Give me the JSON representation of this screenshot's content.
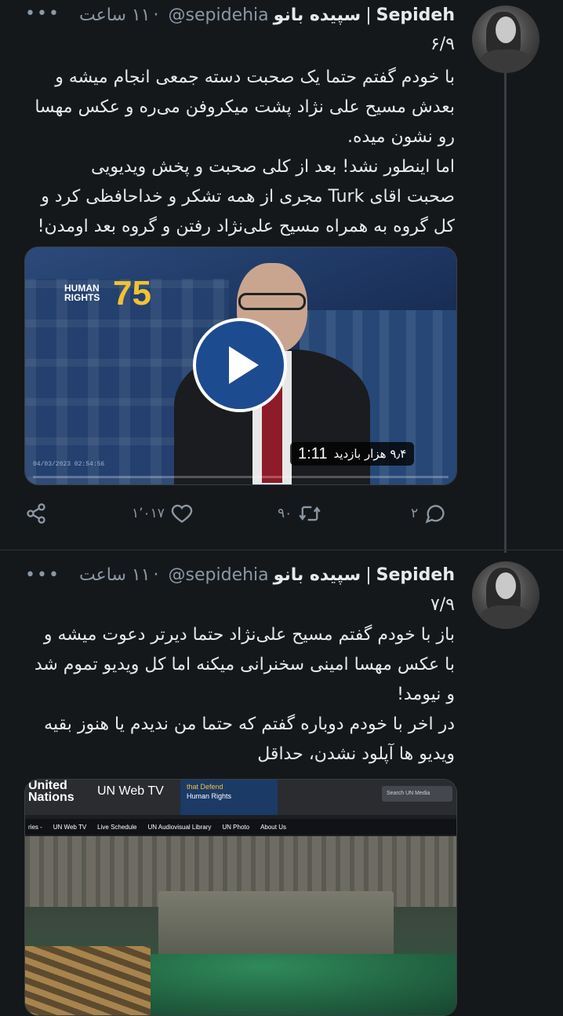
{
  "tweets": [
    {
      "display_name": "Sepideh",
      "persian_name": "سپیده بانو",
      "handle": "@sepidehia",
      "time": "۱۱ ساعت",
      "counter": "۶/۹",
      "lines": [
        "با خودم گفتم حتما یک صحبت دسته جمعی انجام میشه و",
        "بعدش مسیح علی نژاد پشت میکروفن می‌ره و عکس مهسا",
        "رو نشون میده.",
        "اما اینطور نشد! بعد از کلی صحبت و پخش ویدیویی",
        "صحبت اقای Turk مجری از همه تشکر و خداحافظی کرد و",
        "کل گروه به همراه مسیح علی‌نژاد رفتن و گروه بعد اومدن!"
      ],
      "video": {
        "logo_text": "HUMAN RIGHTS",
        "logo_number": "75",
        "duration": "1:11",
        "views": "۹٫۴ هزار بازدید",
        "timecode": "04/03/2023 02:54:56",
        "progress": 0
      },
      "actions": {
        "replies": "۲",
        "retweets": "۹۰",
        "likes": "۱٬۰۱۷"
      }
    },
    {
      "display_name": "Sepideh",
      "persian_name": "سپیده بانو",
      "handle": "@sepidehia",
      "time": "۱۱ ساعت",
      "counter": "۷/۹",
      "lines": [
        "باز با خودم گفتم مسیح علی‌نژاد حتما دیرتر دعوت میشه و",
        "با عکس مهسا امینی سخنرانی میکنه اما کل ویدیو تموم شد",
        "و نیومد!",
        "در اخر با خودم دوباره گفتم که حتما من ندیدم یا هنوز بقیه",
        "ویدیو ها آپلود نشدن، حداقل"
      ],
      "image": {
        "logo_line1": "United",
        "logo_line2": "Nations",
        "webtv": "UN Web TV",
        "banner_line1": "that Defend",
        "banner_line2": "Human Rights",
        "search": "Search UN Media",
        "nav": [
          "ries -",
          "UN Web TV",
          "Live Schedule",
          "UN Audiovisual Library",
          "UN Photo",
          "About Us"
        ]
      }
    }
  ],
  "ui": {
    "more_icon": "more-horizontal-icon",
    "separator": "|",
    "dot": "·"
  },
  "colors": {
    "background": "#15181b",
    "text": "#e7e9ea",
    "muted": "#8b98a5",
    "play_button": "#1d4b8f"
  }
}
